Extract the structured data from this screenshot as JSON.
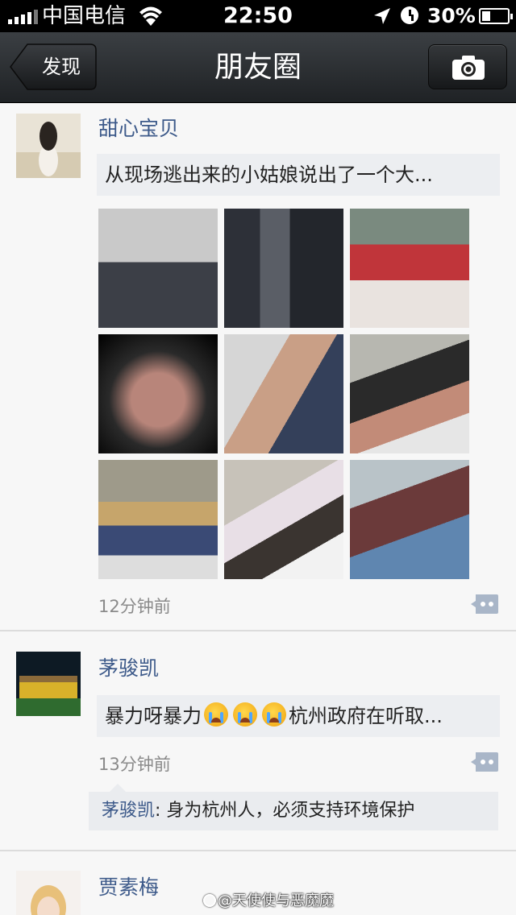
{
  "status_bar": {
    "carrier": "中国电信",
    "time": "22:50",
    "battery": "30%"
  },
  "nav": {
    "back_label": "发现",
    "title": "朋友圈",
    "camera_icon": "camera-icon"
  },
  "posts": [
    {
      "author": "甜心宝贝",
      "text": "从现场逃出来的小姑娘说出了一个大...",
      "time": "12分钟前",
      "photo_count": 9
    },
    {
      "author": "茅骏凯",
      "text_a": "暴力呀暴力",
      "emoji": "crying-face-icon",
      "text_b": "杭州政府在听取...",
      "time": "13分钟前",
      "comment": {
        "author": "茅骏凯",
        "sep": ": ",
        "text": "身为杭州人，必须支持环境保护"
      }
    },
    {
      "author": "贾素梅"
    }
  ],
  "watermark": "@天使使与恶魔魔",
  "colors": {
    "link_blue": "#3d5a8a",
    "bubble_bg": "#eceef1",
    "nav_bg": "#2c2f32"
  }
}
